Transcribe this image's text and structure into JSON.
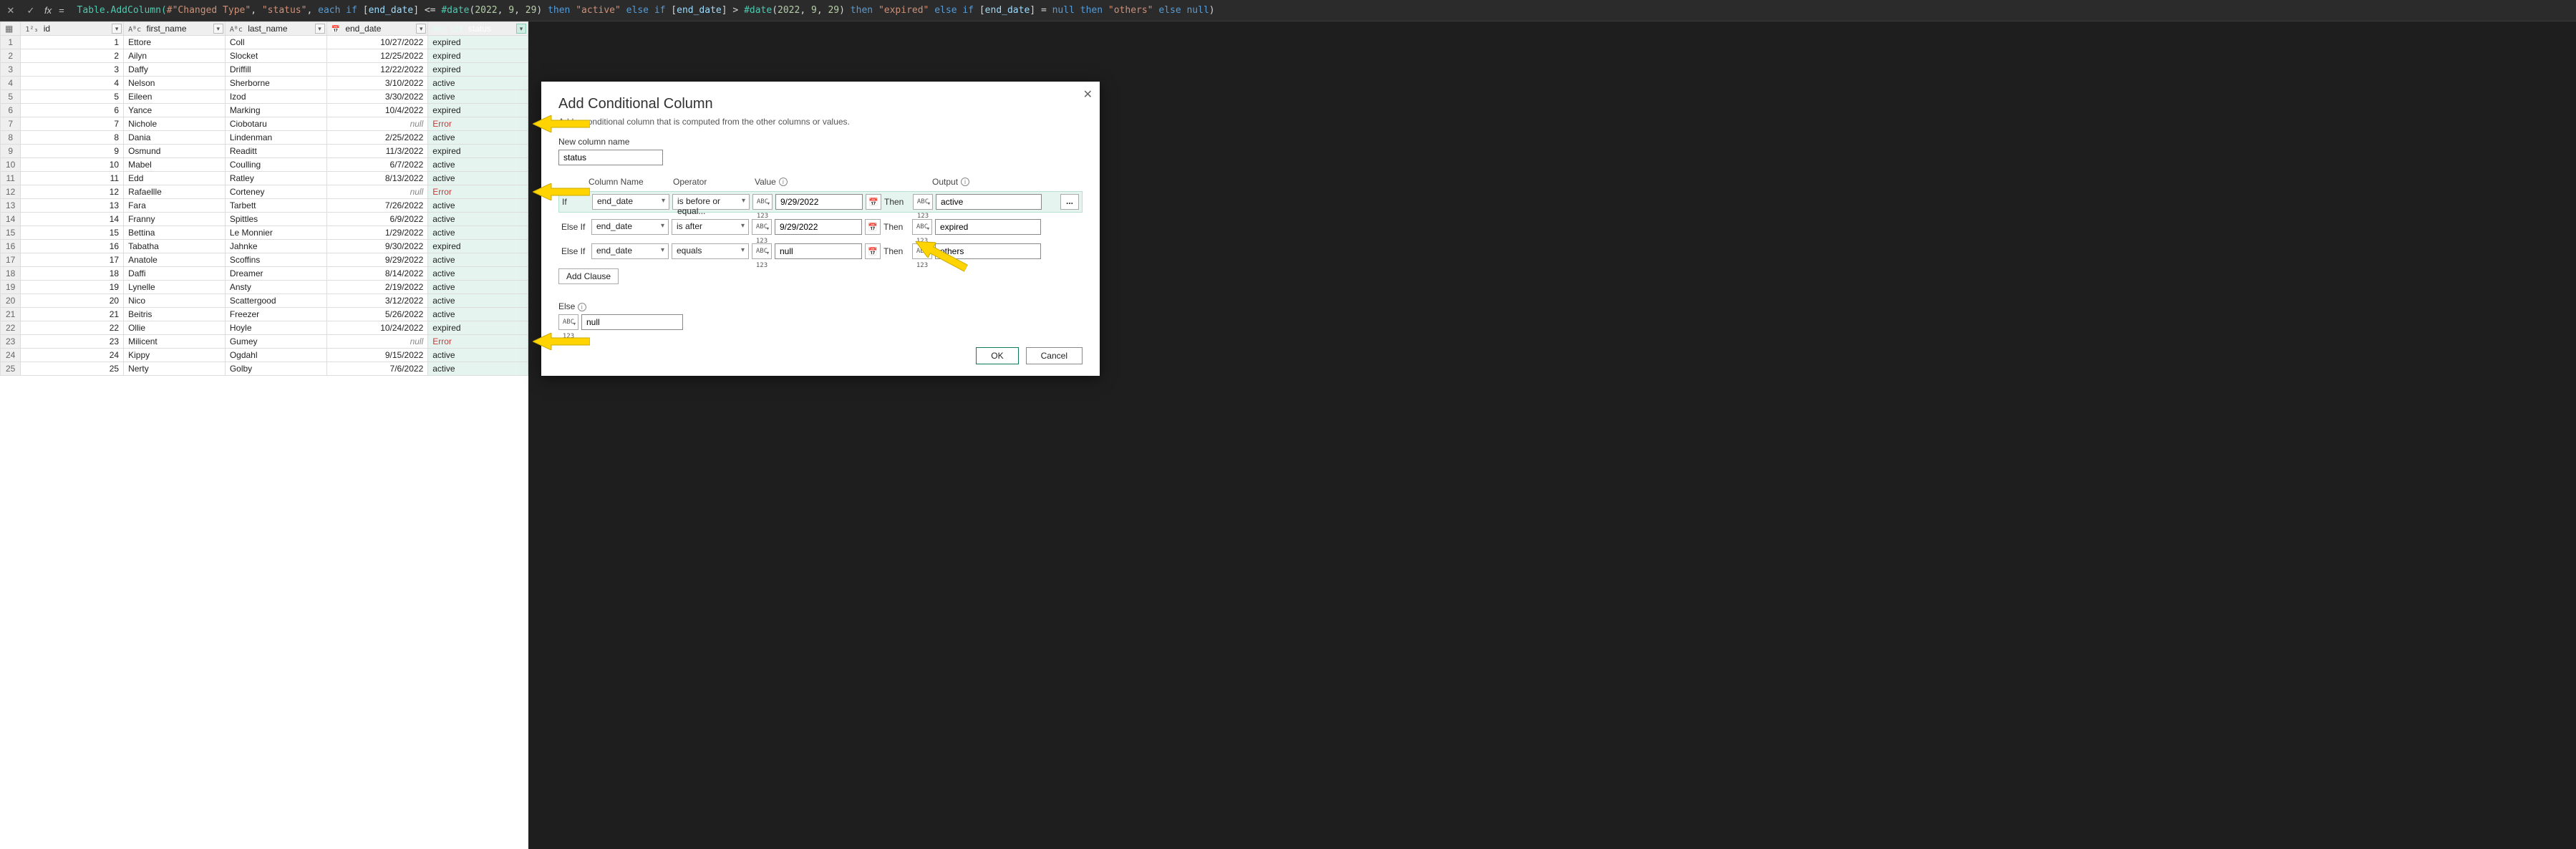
{
  "formula_bar": {
    "fx": "fx",
    "eq": "=",
    "tokens": [
      {
        "t": " ",
        "c": ""
      },
      {
        "t": "Table.AddColumn(",
        "c": "ident"
      },
      {
        "t": "#\"Changed Type\"",
        "c": "str"
      },
      {
        "t": ", ",
        "c": ""
      },
      {
        "t": "\"status\"",
        "c": "str"
      },
      {
        "t": ", ",
        "c": ""
      },
      {
        "t": "each",
        "c": "k-each"
      },
      {
        "t": " ",
        "c": ""
      },
      {
        "t": "if",
        "c": "k-if"
      },
      {
        "t": " [",
        "c": ""
      },
      {
        "t": "end_date",
        "c": "col"
      },
      {
        "t": "] <= ",
        "c": ""
      },
      {
        "t": "#date",
        "c": "ident"
      },
      {
        "t": "(",
        "c": ""
      },
      {
        "t": "2022",
        "c": "num"
      },
      {
        "t": ", ",
        "c": ""
      },
      {
        "t": "9",
        "c": "num"
      },
      {
        "t": ", ",
        "c": ""
      },
      {
        "t": "29",
        "c": "num"
      },
      {
        "t": ") ",
        "c": ""
      },
      {
        "t": "then",
        "c": "k-then"
      },
      {
        "t": " ",
        "c": ""
      },
      {
        "t": "\"active\"",
        "c": "str"
      },
      {
        "t": " ",
        "c": ""
      },
      {
        "t": "else",
        "c": "k-else"
      },
      {
        "t": " ",
        "c": ""
      },
      {
        "t": "if",
        "c": "k-if"
      },
      {
        "t": " [",
        "c": ""
      },
      {
        "t": "end_date",
        "c": "col"
      },
      {
        "t": "] > ",
        "c": ""
      },
      {
        "t": "#date",
        "c": "ident"
      },
      {
        "t": "(",
        "c": ""
      },
      {
        "t": "2022",
        "c": "num"
      },
      {
        "t": ", ",
        "c": ""
      },
      {
        "t": "9",
        "c": "num"
      },
      {
        "t": ", ",
        "c": ""
      },
      {
        "t": "29",
        "c": "num"
      },
      {
        "t": ") ",
        "c": ""
      },
      {
        "t": "then",
        "c": "k-then"
      },
      {
        "t": " ",
        "c": ""
      },
      {
        "t": "\"expired\"",
        "c": "str"
      },
      {
        "t": " ",
        "c": ""
      },
      {
        "t": "else",
        "c": "k-else"
      },
      {
        "t": " ",
        "c": ""
      },
      {
        "t": "if",
        "c": "k-if"
      },
      {
        "t": " [",
        "c": ""
      },
      {
        "t": "end_date",
        "c": "col"
      },
      {
        "t": "] = ",
        "c": ""
      },
      {
        "t": "null",
        "c": "k-null"
      },
      {
        "t": " ",
        "c": ""
      },
      {
        "t": "then",
        "c": "k-then"
      },
      {
        "t": " ",
        "c": ""
      },
      {
        "t": "\"others\"",
        "c": "str"
      },
      {
        "t": " ",
        "c": ""
      },
      {
        "t": "else",
        "c": "k-else"
      },
      {
        "t": " ",
        "c": ""
      },
      {
        "t": "null",
        "c": "k-null"
      },
      {
        "t": ")",
        "c": ""
      }
    ]
  },
  "columns": {
    "id": {
      "type": "1²₃",
      "label": "id"
    },
    "first_name": {
      "type": "Aᴮc",
      "label": "first_name"
    },
    "last_name": {
      "type": "Aᴮc",
      "label": "last_name"
    },
    "end_date": {
      "type": "📅",
      "label": "end_date"
    },
    "status": {
      "type": "ABC\n123",
      "label": "status"
    }
  },
  "rows": [
    {
      "n": 1,
      "id": 1,
      "first": "Ettore",
      "last": "Coll",
      "end": "10/27/2022",
      "status": "expired"
    },
    {
      "n": 2,
      "id": 2,
      "first": "Ailyn",
      "last": "Slocket",
      "end": "12/25/2022",
      "status": "expired"
    },
    {
      "n": 3,
      "id": 3,
      "first": "Daffy",
      "last": "Driffill",
      "end": "12/22/2022",
      "status": "expired"
    },
    {
      "n": 4,
      "id": 4,
      "first": "Nelson",
      "last": "Sherborne",
      "end": "3/10/2022",
      "status": "active"
    },
    {
      "n": 5,
      "id": 5,
      "first": "Eileen",
      "last": "Izod",
      "end": "3/30/2022",
      "status": "active"
    },
    {
      "n": 6,
      "id": 6,
      "first": "Yance",
      "last": "Marking",
      "end": "10/4/2022",
      "status": "expired"
    },
    {
      "n": 7,
      "id": 7,
      "first": "Nichole",
      "last": "Ciobotaru",
      "end": null,
      "status": "Error",
      "error": true,
      "arrow": true
    },
    {
      "n": 8,
      "id": 8,
      "first": "Dania",
      "last": "Lindenman",
      "end": "2/25/2022",
      "status": "active"
    },
    {
      "n": 9,
      "id": 9,
      "first": "Osmund",
      "last": "Readitt",
      "end": "11/3/2022",
      "status": "expired"
    },
    {
      "n": 10,
      "id": 10,
      "first": "Mabel",
      "last": "Coulling",
      "end": "6/7/2022",
      "status": "active"
    },
    {
      "n": 11,
      "id": 11,
      "first": "Edd",
      "last": "Ratley",
      "end": "8/13/2022",
      "status": "active"
    },
    {
      "n": 12,
      "id": 12,
      "first": "Rafaellle",
      "last": "Corteney",
      "end": null,
      "status": "Error",
      "error": true,
      "arrow": true
    },
    {
      "n": 13,
      "id": 13,
      "first": "Fara",
      "last": "Tarbett",
      "end": "7/26/2022",
      "status": "active"
    },
    {
      "n": 14,
      "id": 14,
      "first": "Franny",
      "last": "Spittles",
      "end": "6/9/2022",
      "status": "active"
    },
    {
      "n": 15,
      "id": 15,
      "first": "Bettina",
      "last": "Le Monnier",
      "end": "1/29/2022",
      "status": "active"
    },
    {
      "n": 16,
      "id": 16,
      "first": "Tabatha",
      "last": "Jahnke",
      "end": "9/30/2022",
      "status": "expired"
    },
    {
      "n": 17,
      "id": 17,
      "first": "Anatole",
      "last": "Scoffins",
      "end": "9/29/2022",
      "status": "active"
    },
    {
      "n": 18,
      "id": 18,
      "first": "Daffi",
      "last": "Dreamer",
      "end": "8/14/2022",
      "status": "active"
    },
    {
      "n": 19,
      "id": 19,
      "first": "Lynelle",
      "last": "Ansty",
      "end": "2/19/2022",
      "status": "active"
    },
    {
      "n": 20,
      "id": 20,
      "first": "Nico",
      "last": "Scattergood",
      "end": "3/12/2022",
      "status": "active"
    },
    {
      "n": 21,
      "id": 21,
      "first": "Beitris",
      "last": "Freezer",
      "end": "5/26/2022",
      "status": "active"
    },
    {
      "n": 22,
      "id": 22,
      "first": "Ollie",
      "last": "Hoyle",
      "end": "10/24/2022",
      "status": "expired"
    },
    {
      "n": 23,
      "id": 23,
      "first": "Milicent",
      "last": "Gumey",
      "end": null,
      "status": "Error",
      "error": true,
      "arrow": true
    },
    {
      "n": 24,
      "id": 24,
      "first": "Kippy",
      "last": "Ogdahl",
      "end": "9/15/2022",
      "status": "active"
    },
    {
      "n": 25,
      "id": 25,
      "first": "Nerty",
      "last": "Golby",
      "end": "7/6/2022",
      "status": "active"
    }
  ],
  "dialog": {
    "title": "Add Conditional Column",
    "subtitle": "Add a conditional column that is computed from the other columns or values.",
    "new_name_label": "New column name",
    "new_name_value": "status",
    "headers": {
      "col": "Column Name",
      "op": "Operator",
      "val": "Value",
      "out": "Output"
    },
    "then_label": "Then",
    "clauses": [
      {
        "lbl": "If",
        "col": "end_date",
        "op": "is before or equal...",
        "val": "9/29/2022",
        "out": "active",
        "first": true,
        "datebtn": true
      },
      {
        "lbl": "Else If",
        "col": "end_date",
        "op": "is after",
        "val": "9/29/2022",
        "out": "expired",
        "datebtn": true
      },
      {
        "lbl": "Else If",
        "col": "end_date",
        "op": "equals",
        "val": "null",
        "out": "others",
        "datebtn": true,
        "arrow": true
      }
    ],
    "type_chip": "ABC\n123",
    "add_clause": "Add Clause",
    "else_label": "Else",
    "else_value": "null",
    "ok": "OK",
    "cancel": "Cancel",
    "ellipsis": "...",
    "null_text": "null"
  }
}
